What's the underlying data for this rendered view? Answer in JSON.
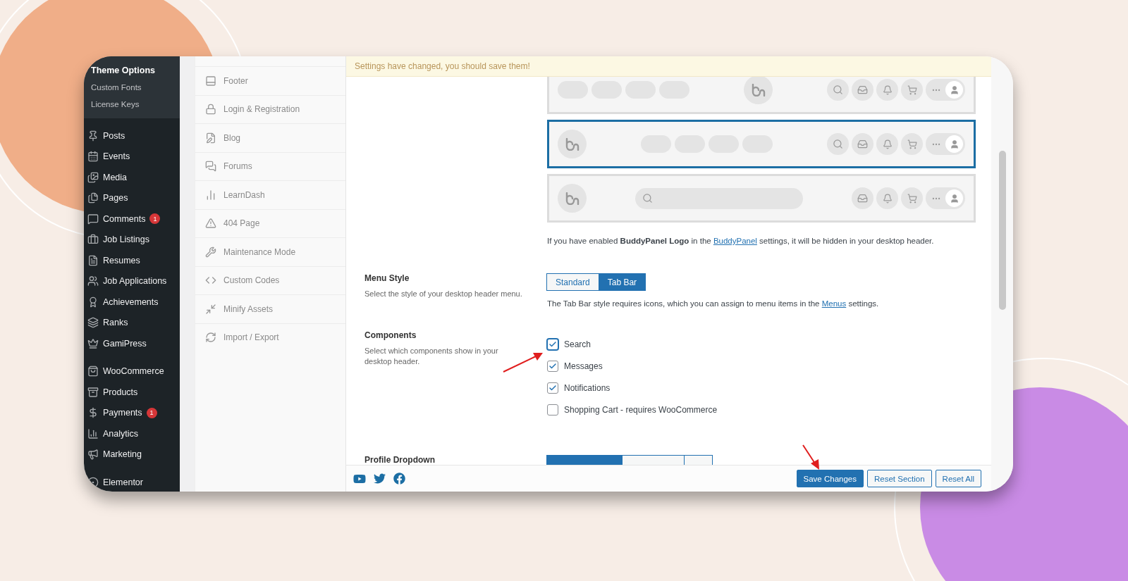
{
  "sidebar": {
    "submenu": [
      {
        "label": "Theme Options",
        "selected": true
      },
      {
        "label": "Custom Fonts",
        "selected": false
      },
      {
        "label": "License Keys",
        "selected": false
      }
    ],
    "groups": [
      {
        "items": [
          {
            "label": "Posts"
          },
          {
            "label": "Events"
          },
          {
            "label": "Media"
          },
          {
            "label": "Pages"
          },
          {
            "label": "Comments",
            "badge": "1"
          },
          {
            "label": "Job Listings"
          },
          {
            "label": "Resumes"
          },
          {
            "label": "Job Applications"
          },
          {
            "label": "Achievements"
          },
          {
            "label": "Ranks"
          },
          {
            "label": "GamiPress"
          }
        ]
      },
      {
        "items": [
          {
            "label": "WooCommerce"
          },
          {
            "label": "Products"
          },
          {
            "label": "Payments",
            "badge": "1"
          },
          {
            "label": "Analytics"
          },
          {
            "label": "Marketing"
          }
        ]
      },
      {
        "items": [
          {
            "label": "Elementor"
          }
        ]
      }
    ]
  },
  "options_nav": {
    "items": [
      "Footer",
      "Login & Registration",
      "Blog",
      "Forums",
      "LearnDash",
      "404 Page",
      "Maintenance Mode",
      "Custom Codes",
      "Minify Assets",
      "Import / Export"
    ]
  },
  "notice": "Settings have changed, you should save them!",
  "header_layouts": {
    "options": [
      {
        "kind": "centered-logo",
        "selected": false
      },
      {
        "kind": "left-logo",
        "selected": true
      },
      {
        "kind": "search-bar",
        "selected": false
      }
    ],
    "note": {
      "before": "If you have enabled **BuddyPanel Logo** in the ",
      "link": "BuddyPanel",
      "after": " settings, it will be hidden in your desktop header."
    }
  },
  "menu_style": {
    "label": "Menu Style",
    "description": "Select the style of your desktop header menu.",
    "options": [
      {
        "label": "Standard",
        "selected": false
      },
      {
        "label": "Tab Bar",
        "selected": true
      }
    ],
    "note": {
      "before": "The Tab Bar style requires icons, which you can assign to menu items in the ",
      "link": "Menus",
      "after": " settings."
    }
  },
  "components": {
    "label": "Components",
    "description": "Select which components show in your desktop header.",
    "options": [
      {
        "label": "Search",
        "checked": true
      },
      {
        "label": "Messages",
        "checked": true
      },
      {
        "label": "Notifications",
        "checked": true
      },
      {
        "label": "Shopping Cart - requires WooCommerce",
        "checked": false
      }
    ]
  },
  "profile_dropdown": {
    "label": "Profile Dropdown",
    "options": [
      {
        "selected": true
      },
      {
        "selected": false
      },
      {
        "selected": false
      }
    ]
  },
  "footer": {
    "buttons": [
      {
        "label": "Save Changes",
        "kind": "primary"
      },
      {
        "label": "Reset Section",
        "kind": "secondary"
      },
      {
        "label": "Reset All",
        "kind": "secondary"
      }
    ]
  }
}
